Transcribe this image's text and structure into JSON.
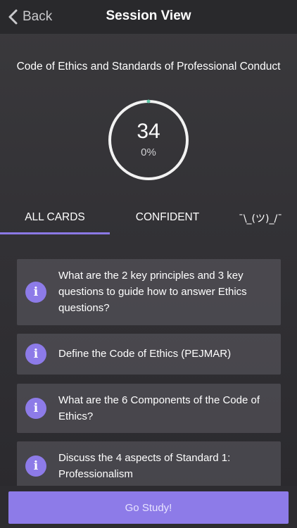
{
  "nav": {
    "back_label": "Back",
    "title": "Session View"
  },
  "deck": {
    "title": "Code of Ethics and Standards of Professional Conduct"
  },
  "progress": {
    "count": "34",
    "percent_label": "0%",
    "percent_value": 0
  },
  "tabs": [
    {
      "label": "ALL CARDS",
      "active": true
    },
    {
      "label": "CONFIDENT",
      "active": false
    },
    {
      "label": "¯\\_(ツ)_/¯",
      "active": false
    }
  ],
  "cards": [
    {
      "text": "What are the 2 key principles and 3 key questions to guide how to answer Ethics questions?"
    },
    {
      "text": "Define the Code of Ethics (PEJMAR)"
    },
    {
      "text": "What are the 6 Components of the Code of Ethics?"
    },
    {
      "text": "Discuss the 4 aspects of Standard 1: Professionalism"
    }
  ],
  "info_icon_glyph": "i",
  "footer": {
    "study_label": "Go Study!"
  },
  "colors": {
    "accent": "#8d7be8",
    "ring_dot": "#5fc9a8"
  }
}
